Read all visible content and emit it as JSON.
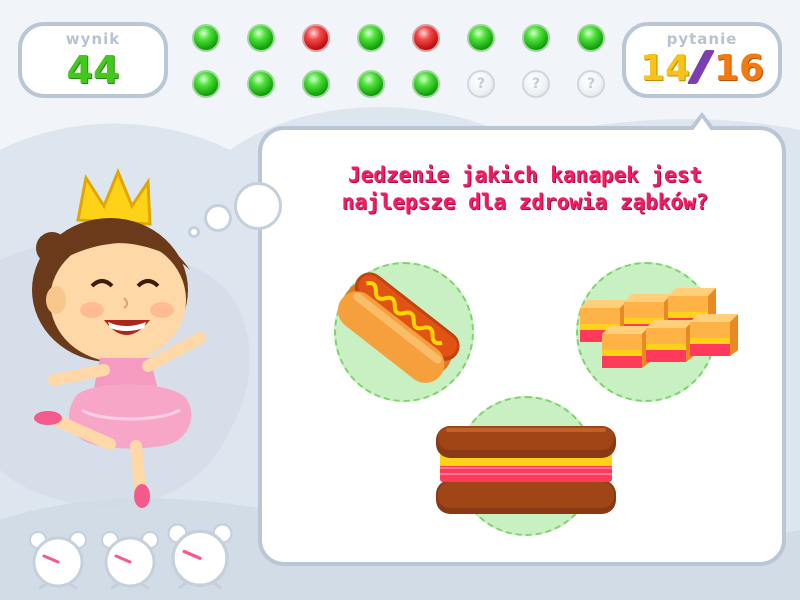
{
  "score": {
    "label": "wynik",
    "value": "44"
  },
  "question_counter": {
    "label": "pytanie",
    "current": "14",
    "total": "16"
  },
  "progress": {
    "row1": [
      "correct",
      "correct",
      "wrong",
      "correct",
      "wrong",
      "correct",
      "correct",
      "correct"
    ],
    "row2": [
      "correct",
      "correct",
      "correct",
      "correct",
      "correct",
      "unanswered",
      "unanswered",
      "unanswered"
    ],
    "unanswered_symbol": "?"
  },
  "question": {
    "line1": "Jedzenie jakich kanapek jest",
    "line2": "najlepsze dla zdrowia ząbków?"
  },
  "answers": [
    {
      "name": "hotdog",
      "icon": "hotdog-icon"
    },
    {
      "name": "canapes",
      "icon": "canapes-icon"
    },
    {
      "name": "sandwich",
      "icon": "sandwich-icon"
    }
  ],
  "lives": {
    "count": 3,
    "icon": "alarm-clock-icon"
  },
  "colors": {
    "correct": "#2bbf1c",
    "wrong": "#d21a1a",
    "question_text": "#f21d64",
    "score_text": "#44c81f",
    "current_question": "#f7c21a",
    "total_questions": "#f37a10",
    "panel_border": "#b9c6d6"
  }
}
